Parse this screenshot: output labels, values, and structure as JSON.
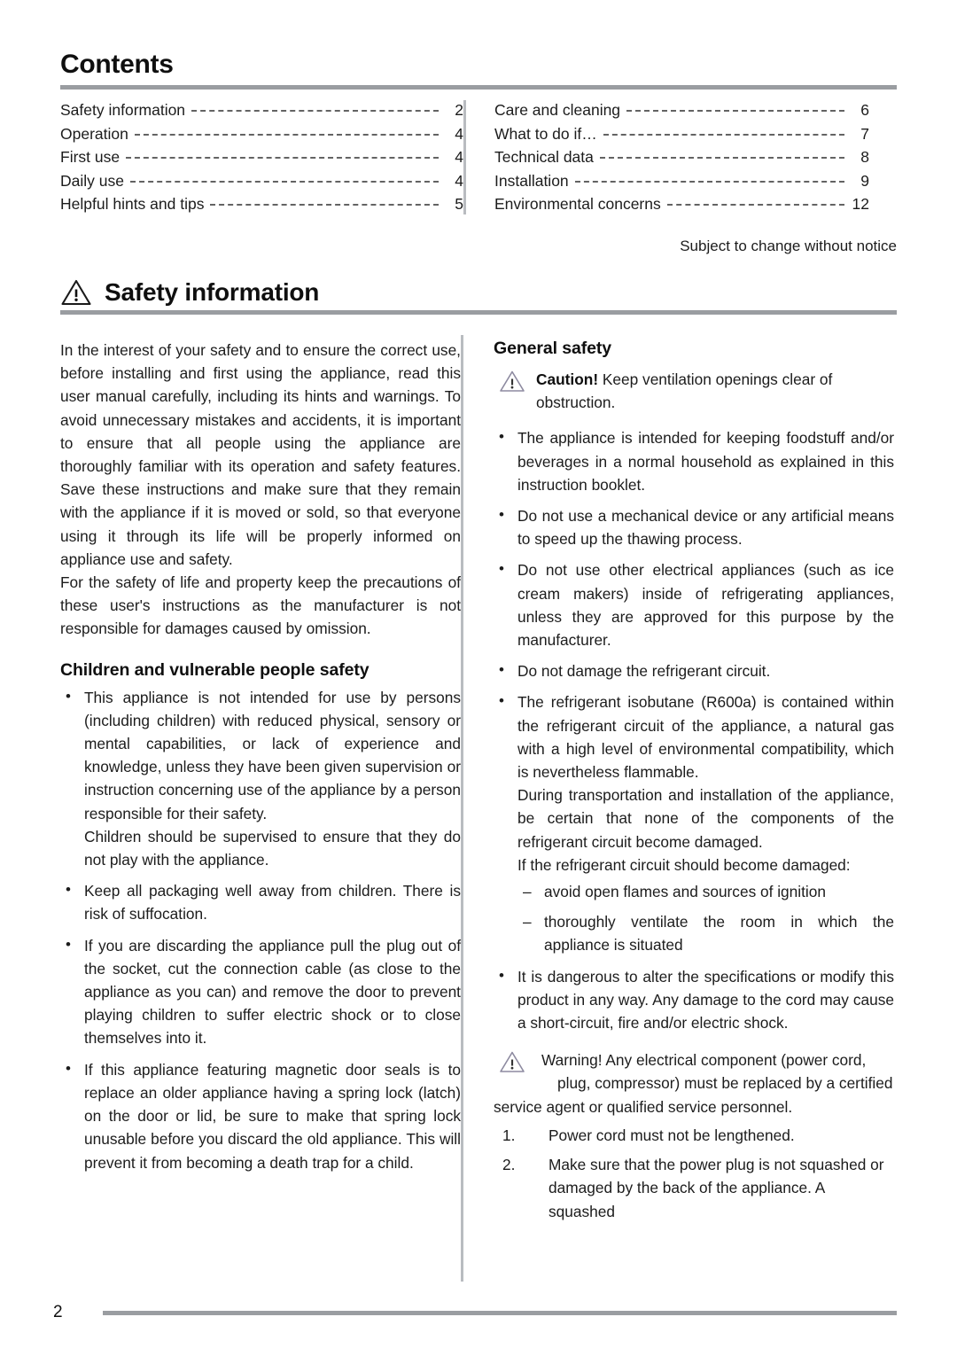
{
  "document": {
    "page_number": "2",
    "subject_note": "Subject to change without notice"
  },
  "contents": {
    "title": "Contents",
    "left_entries": [
      {
        "label": "Safety information",
        "page": "2"
      },
      {
        "label": "Operation",
        "page": "4"
      },
      {
        "label": "First use",
        "page": "4"
      },
      {
        "label": "Daily use",
        "page": "4"
      },
      {
        "label": "Helpful hints and tips",
        "page": "5"
      }
    ],
    "right_entries": [
      {
        "label": "Care and cleaning",
        "page": "6"
      },
      {
        "label": "What to do if…",
        "page": "7"
      },
      {
        "label": "Technical data",
        "page": "8"
      },
      {
        "label": "Installation",
        "page": "9"
      },
      {
        "label": "Environmental concerns",
        "page": "12"
      }
    ]
  },
  "safety_section": {
    "heading": "Safety information",
    "heading_icon": "warning-triangle-icon",
    "intro_paragraph_1": "In the interest of your safety and to ensure the correct use, before installing and first using the appliance, read this user manual carefully, including its hints and warnings. To avoid unnecessary mistakes and accidents, it is important to ensure that all people using the appliance are thoroughly familiar with its operation and safety features. Save these instructions and make sure that they remain with the appliance if it is moved or sold, so that everyone using it through its life will be properly informed on appliance use and safety.",
    "intro_paragraph_2": "For the safety of life and property keep the precautions of these user's instructions as the manufacturer is not responsible for damages caused by omission.",
    "children_safety": {
      "heading": "Children and vulnerable people safety",
      "bullets": [
        {
          "text": "This appliance is not intended for use by persons (including children) with reduced physical, sensory or mental capabilities, or lack of experience and knowledge, unless they have been given supervision or instruction concerning use of the appliance by a person responsible for their safety.",
          "continuation": "Children should be supervised to ensure that they do not play with the appliance."
        },
        {
          "text": "Keep all packaging well away from children. There is risk of suffocation.",
          "continuation": ""
        },
        {
          "text": "If you are discarding the appliance pull the plug out of the socket, cut the connection cable (as close to the appliance as you can) and remove the door to prevent playing children to suffer electric shock or to close themselves into it.",
          "continuation": ""
        },
        {
          "text": "If this appliance featuring magnetic door seals is to replace an older appliance having a spring lock (latch) on the door or lid, be sure to make that spring lock unusable before you discard the old appliance. This will prevent it from becoming a death trap for a child.",
          "continuation": ""
        }
      ]
    },
    "general_safety": {
      "heading": "General safety",
      "caution": {
        "icon": "warning-triangle-icon",
        "keyword": "Caution!",
        "text": "Keep ventilation openings clear of obstruction."
      },
      "bullets": [
        {
          "text": "The appliance is intended for keeping foodstuff and/or beverages in a normal household as explained in this instruction booklet."
        },
        {
          "text": "Do not use a mechanical device or any artificial means to speed up the thawing process."
        },
        {
          "text": "Do not use other electrical appliances (such as ice cream makers) inside of refrigerating appliances, unless they are approved for this purpose by the manufacturer."
        },
        {
          "text": "Do not damage the refrigerant circuit."
        }
      ],
      "refrigerant_bullet": {
        "text": "The refrigerant isobutane (R600a) is contained within the refrigerant circuit of the appliance, a natural gas with a high level of environmental compatibility, which is nevertheless flammable.",
        "continuation_1": "During transportation and installation of the appliance, be certain that none of the components of the refrigerant circuit become damaged.",
        "continuation_2": "If the refrigerant circuit should become damaged:",
        "dashes": [
          "avoid open flames and sources of ignition",
          "thoroughly ventilate the room in which the appliance is situated"
        ]
      },
      "danger_bullet": {
        "text": "It is dangerous to alter the specifications or modify this product in any way. Any damage to the cord may cause a short-circuit, fire and/or electric shock."
      },
      "warning": {
        "icon": "warning-triangle-icon",
        "keyword": "Warning!",
        "line1": "Any electrical component (power cord,",
        "line2": "plug, compressor) must be replaced by a certified",
        "line3": "service agent or qualified service personnel."
      },
      "numbered": [
        "Power cord must not be lengthened.",
        "Make sure that the power plug is not squashed or damaged by the back of the appliance. A squashed"
      ]
    }
  },
  "colors": {
    "rule": "#9a9da1",
    "divider": "#b9bcc0",
    "text": "#1c1c1c",
    "heading": "#0f0f0f"
  }
}
